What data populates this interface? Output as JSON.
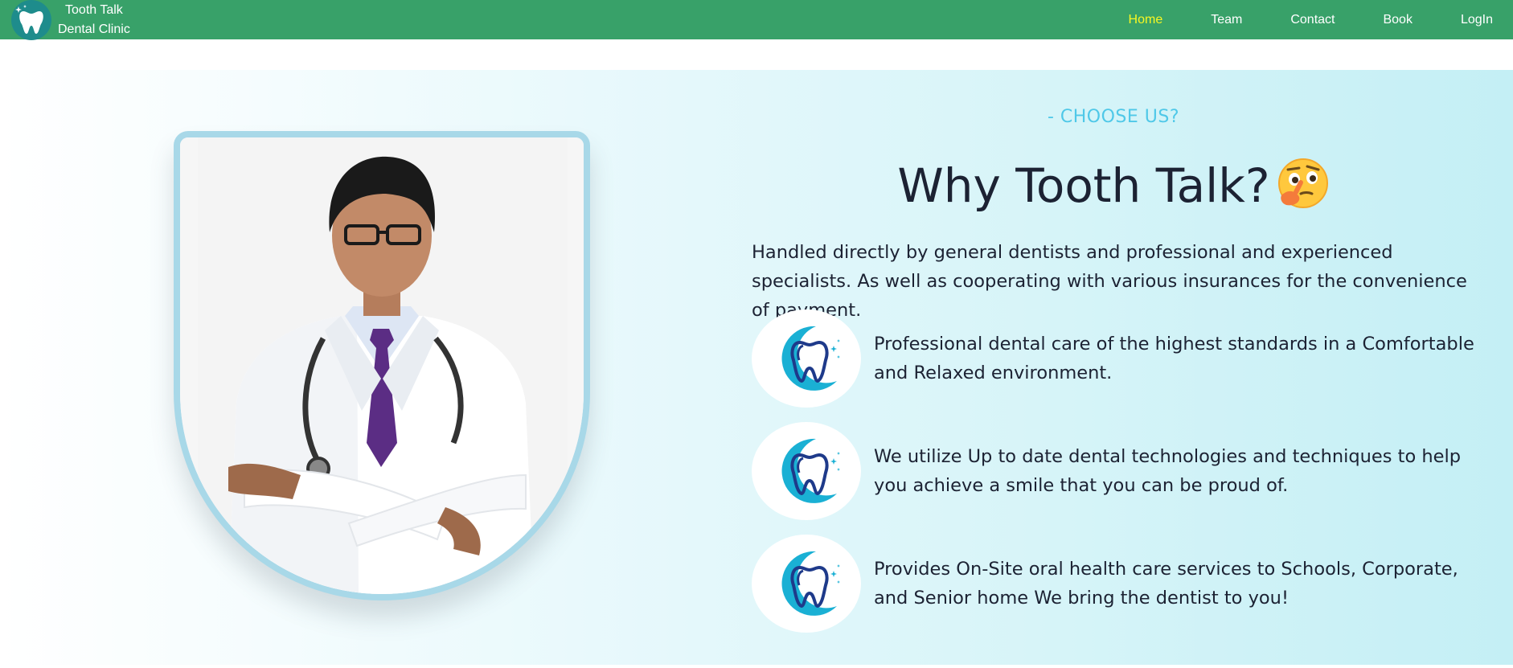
{
  "brand": {
    "line1": "Tooth Talk",
    "line2": "Dental Clinic",
    "logo_icon": "tooth-sparkle-icon"
  },
  "nav": {
    "items": [
      {
        "label": "Home",
        "active": true
      },
      {
        "label": "Team",
        "active": false
      },
      {
        "label": "Contact",
        "active": false
      },
      {
        "label": "Book",
        "active": false
      },
      {
        "label": "LogIn",
        "active": false
      }
    ]
  },
  "section": {
    "eyebrow": "- CHOOSE US?",
    "heading": "Why Tooth Talk?",
    "heading_emoji": "thinking-face-emoji",
    "intro": "Handled directly by general dentists and professional and experienced specialists. As well as cooperating with various insurances for the convenience of payment.",
    "features": [
      {
        "icon": "tooth-logo-icon",
        "text": "Professional dental care of the highest standards in a Comfortable and Relaxed environment."
      },
      {
        "icon": "tooth-logo-icon",
        "text": "We utilize Up to date dental technologies and techniques to help you achieve a smile that you can be proud of."
      },
      {
        "icon": "tooth-logo-icon",
        "text": "Provides On-Site oral health care services to Schools, Corporate, and Senior home We bring the dentist to you!"
      }
    ],
    "image": "doctor-photo"
  },
  "colors": {
    "navbar": "#38a169",
    "nav_active": "#f7f722",
    "eyebrow": "#4fc8e8",
    "frame_border": "#a8d8e8",
    "heading": "#1c2233"
  }
}
